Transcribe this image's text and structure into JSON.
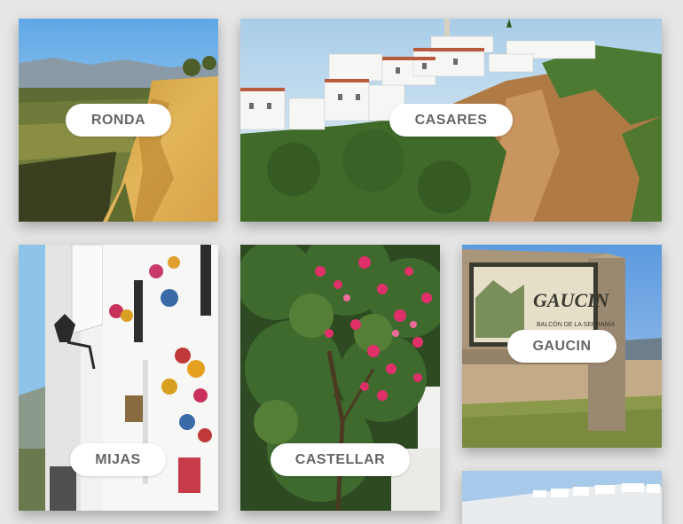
{
  "gallery": {
    "items": [
      {
        "label": "RONDA",
        "scene": "cliffs-valley-photo"
      },
      {
        "label": "CASARES",
        "scene": "white-village-on-cliff-photo"
      },
      {
        "label": "MIJAS",
        "scene": "whitewashed-street-photo"
      },
      {
        "label": "CASTELLAR",
        "scene": "bougainvillea-tree-photo"
      },
      {
        "label": "GAUCIN",
        "scene": "gaucin-sign-photo"
      },
      {
        "label": "",
        "scene": "white-village-photo"
      }
    ],
    "sign_text": "GAUCIN",
    "sign_subtext": "BALCÓN DE LA SERRANÍA"
  },
  "colors": {
    "background": "#e6e6e6",
    "pill_bg": "#ffffff",
    "pill_text": "#666666"
  }
}
